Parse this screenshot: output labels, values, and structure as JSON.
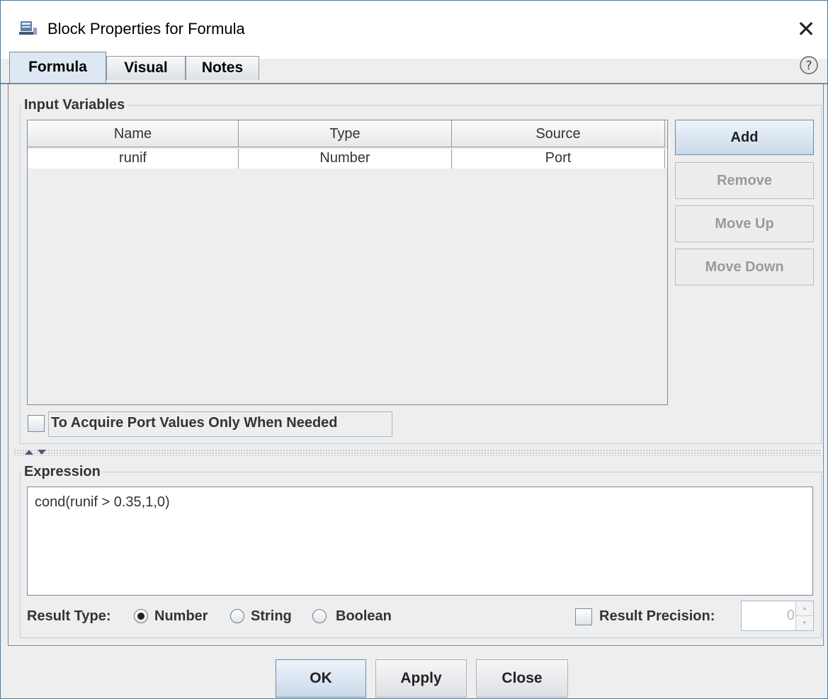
{
  "window": {
    "title": "Block Properties for Formula"
  },
  "tabs": [
    {
      "label": "Formula",
      "active": true
    },
    {
      "label": "Visual",
      "active": false
    },
    {
      "label": "Notes",
      "active": false
    }
  ],
  "icons": {
    "app": "block-properties-icon",
    "close": "close-icon",
    "help": "help-icon"
  },
  "input_variables": {
    "legend": "Input Variables",
    "columns": [
      "Name",
      "Type",
      "Source"
    ],
    "rows": [
      {
        "name": "runif",
        "type": "Number",
        "source": "Port"
      }
    ],
    "buttons": {
      "add": "Add",
      "remove": "Remove",
      "move_up": "Move Up",
      "move_down": "Move Down"
    },
    "acquire_checkbox_label": "To Acquire Port Values Only When Needed",
    "acquire_checked": false
  },
  "expression": {
    "legend": "Expression",
    "value": "cond(runif > 0.35,1,0)",
    "result_type_label": "Result Type:",
    "result_types": [
      "Number",
      "String",
      "Boolean"
    ],
    "selected_result_type": "Number",
    "result_precision_label": "Result Precision:",
    "result_precision_checked": false,
    "result_precision_value": "0"
  },
  "footer": {
    "ok": "OK",
    "apply": "Apply",
    "close": "Close"
  },
  "colors": {
    "window_border": "#3c7fb1",
    "group_border": "#b8cfe5",
    "background": "#eeeeee"
  }
}
